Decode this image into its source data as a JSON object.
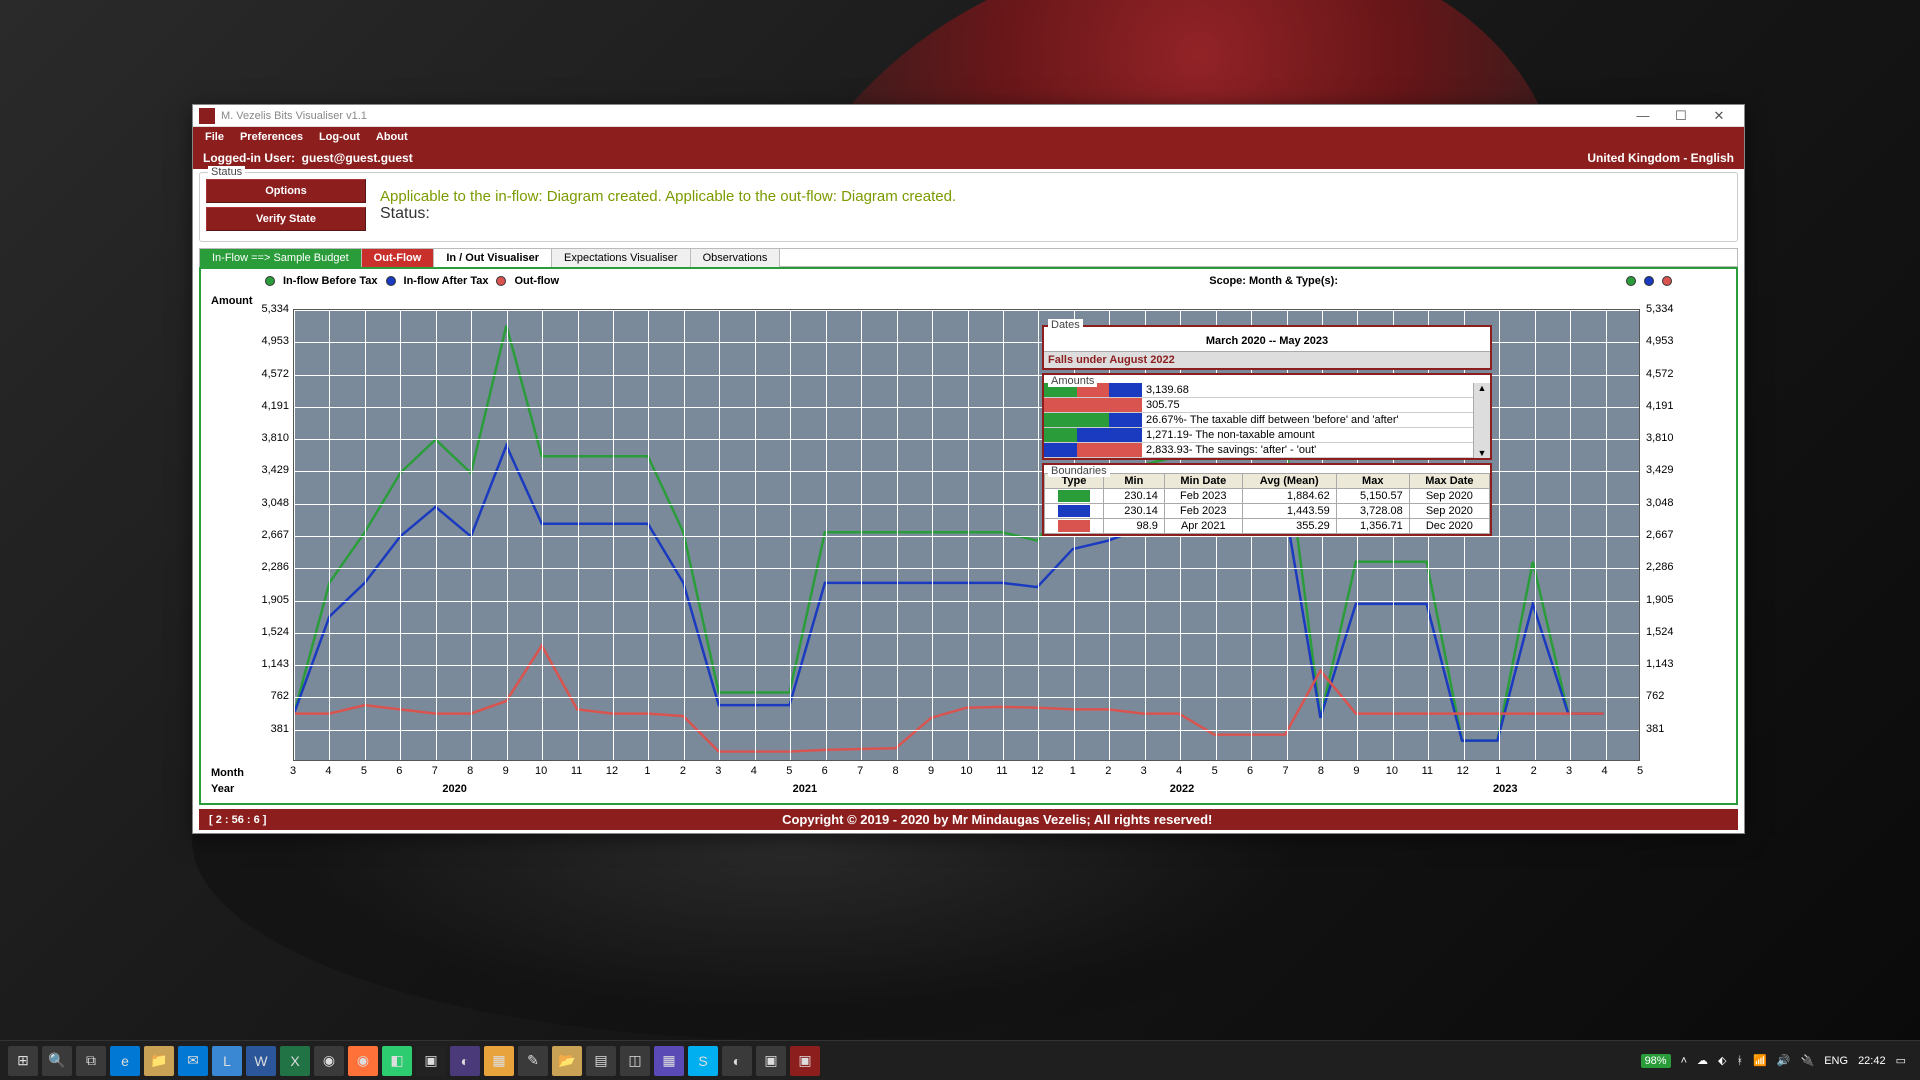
{
  "window": {
    "title": "M. Vezelis Bits Visualiser v1.1"
  },
  "menu": {
    "file": "File",
    "preferences": "Preferences",
    "logout": "Log-out",
    "about": "About"
  },
  "user_bar": {
    "label": "Logged-in User:",
    "user": "guest@guest.guest",
    "locale": "United Kingdom - English"
  },
  "status": {
    "legend": "Status",
    "options": "Options",
    "verify": "Verify State",
    "label": "Status:",
    "message": "Applicable to the in-flow:  Diagram created. Applicable to the out-flow:  Diagram created."
  },
  "tabs": {
    "inflow": "In-Flow ==> Sample Budget",
    "outflow": "Out-Flow",
    "inout": "In / Out Visualiser",
    "expectations": "Expectations Visualiser",
    "observations": "Observations"
  },
  "chart": {
    "legend": {
      "before": "In-flow Before Tax",
      "after": "In-flow After Tax",
      "out": "Out-flow"
    },
    "scope_label": "Scope: Month & Type(s):",
    "amount_label": "Amount",
    "month_label": "Month",
    "year_label": "Year"
  },
  "dates_panel": {
    "legend": "Dates",
    "range": "March 2020 -- May 2023",
    "falls_under": "Falls under August 2022"
  },
  "amounts_panel": {
    "legend": "Amounts",
    "rows": [
      {
        "c1": "#2a9d3a",
        "c2": "#d9534f",
        "c3": "#1a3abf",
        "text": "3,139.68"
      },
      {
        "c1": "#d9534f",
        "c2": "#d9534f",
        "c3": "#d9534f",
        "text": "305.75"
      },
      {
        "c1": "#2a9d3a",
        "c2": "#2a9d3a",
        "c3": "#1a3abf",
        "text": "26.67%- The taxable diff between 'before' and 'after'"
      },
      {
        "c1": "#2a9d3a",
        "c2": "#1a3abf",
        "c3": "#1a3abf",
        "text": "1,271.19- The non-taxable amount"
      },
      {
        "c1": "#1a3abf",
        "c2": "#d9534f",
        "c3": "#d9534f",
        "text": "2,833.93- The savings: 'after' - 'out'"
      }
    ]
  },
  "boundaries_panel": {
    "legend": "Boundaries",
    "headers": {
      "type": "Type",
      "min": "Min",
      "mindate": "Min Date",
      "avg": "Avg (Mean)",
      "max": "Max",
      "maxdate": "Max Date"
    },
    "rows": [
      {
        "color": "#2a9d3a",
        "min": "230.14",
        "mindate": "Feb 2023",
        "avg": "1,884.62",
        "max": "5,150.57",
        "maxdate": "Sep 2020"
      },
      {
        "color": "#1a3abf",
        "min": "230.14",
        "mindate": "Feb 2023",
        "avg": "1,443.59",
        "max": "3,728.08",
        "maxdate": "Sep 2020"
      },
      {
        "color": "#d9534f",
        "min": "98.9",
        "mindate": "Apr 2021",
        "avg": "355.29",
        "max": "1,356.71",
        "maxdate": "Dec 2020"
      }
    ]
  },
  "footer": {
    "timer": "[ 2 : 56 : 6 ]",
    "copyright": "Copyright © 2019 - 2020 by Mr Mindaugas Vezelis; All rights reserved!"
  },
  "taskbar": {
    "battery": "98%",
    "lang": "ENG",
    "time": "22:42"
  },
  "chart_data": {
    "type": "line",
    "xlabel": "Month / Year",
    "ylabel": "Amount",
    "ylim": [
      0,
      5334
    ],
    "y_ticks": [
      381,
      762,
      1143,
      1524,
      1905,
      2286,
      2667,
      3048,
      3429,
      3810,
      4191,
      4572,
      4953,
      5334
    ],
    "categories_months": [
      3,
      4,
      5,
      6,
      7,
      8,
      9,
      10,
      11,
      12,
      1,
      2,
      3,
      4,
      5,
      6,
      7,
      8,
      9,
      10,
      11,
      12,
      1,
      2,
      3,
      4,
      5,
      6,
      7,
      8,
      9,
      10,
      11,
      12,
      1,
      2,
      3,
      4,
      5
    ],
    "years": [
      2020,
      2021,
      2022,
      2023
    ],
    "series": [
      {
        "name": "In-flow Before Tax",
        "color": "#2a9d3a",
        "values": [
          550,
          2100,
          2700,
          3400,
          3800,
          3400,
          5150,
          3600,
          3600,
          3600,
          3600,
          2700,
          800,
          800,
          800,
          2700,
          2700,
          2700,
          2700,
          2700,
          2700,
          2600,
          3200,
          3300,
          3500,
          3600,
          3700,
          3800,
          3800,
          500,
          2350,
          2350,
          2350,
          230,
          230,
          2350,
          550,
          550,
          null
        ]
      },
      {
        "name": "In-flow After Tax",
        "color": "#1a3abf",
        "values": [
          550,
          1700,
          2100,
          2650,
          3000,
          2650,
          3728,
          2800,
          2800,
          2800,
          2800,
          2100,
          650,
          650,
          650,
          2100,
          2100,
          2100,
          2100,
          2100,
          2100,
          2050,
          2500,
          2600,
          2750,
          2850,
          2900,
          3000,
          3000,
          500,
          1850,
          1850,
          1850,
          230,
          230,
          1850,
          550,
          550,
          null
        ]
      },
      {
        "name": "Out-flow",
        "color": "#d9534f",
        "values": [
          550,
          550,
          650,
          600,
          550,
          550,
          700,
          1356,
          600,
          550,
          550,
          520,
          100,
          100,
          100,
          120,
          130,
          140,
          500,
          620,
          630,
          620,
          600,
          600,
          550,
          550,
          300,
          300,
          300,
          1060,
          550,
          550,
          550,
          550,
          550,
          550,
          550,
          550,
          null
        ]
      }
    ]
  }
}
